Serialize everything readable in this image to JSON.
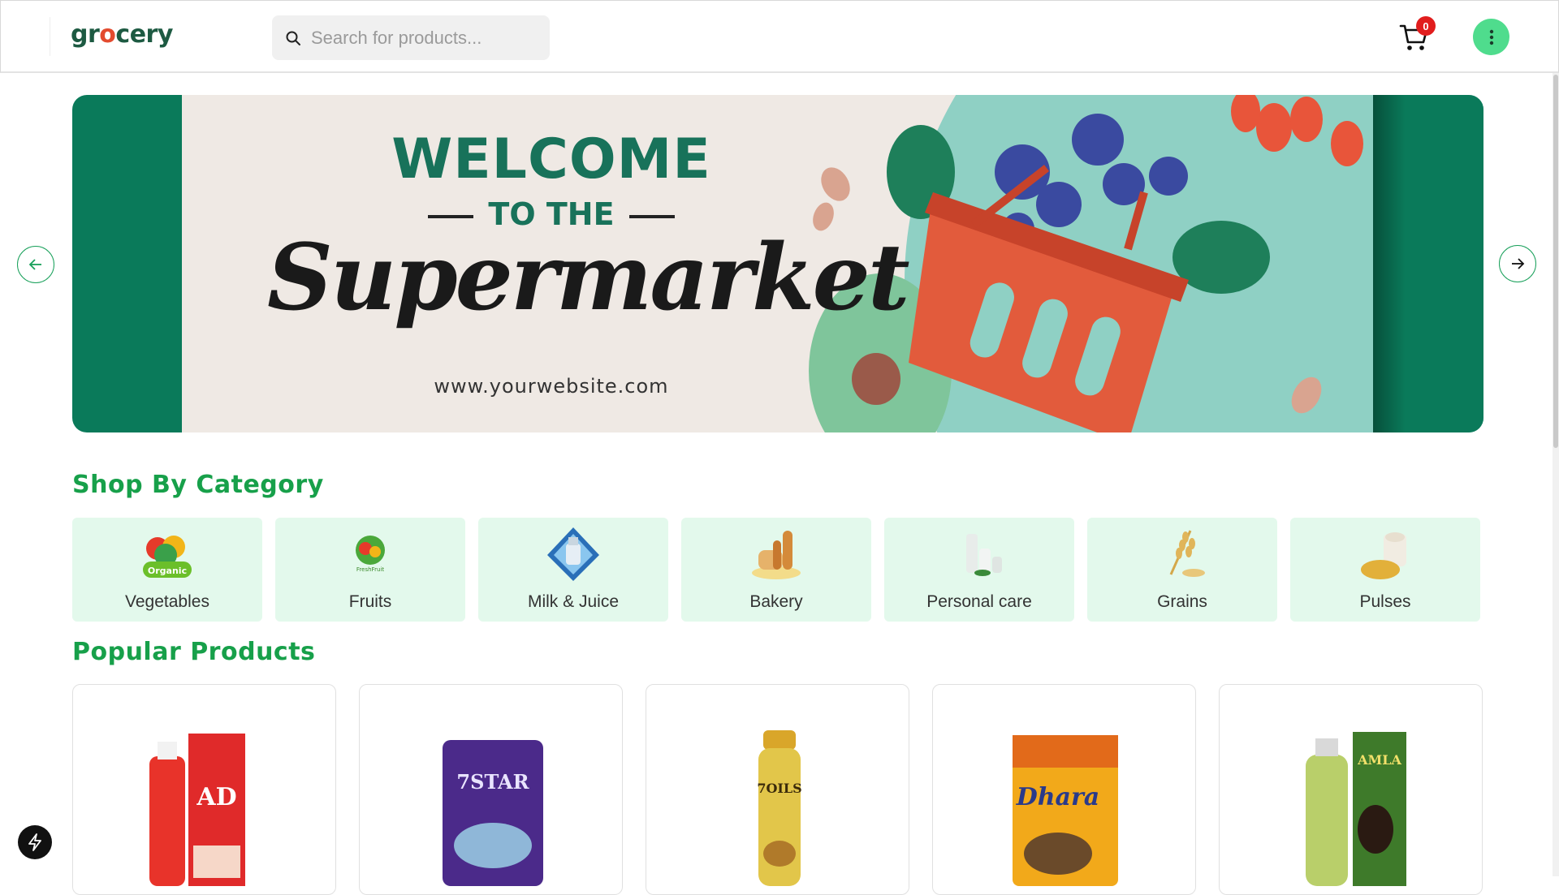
{
  "header": {
    "logo_prefix": "gr",
    "logo_o": "o",
    "logo_suffix": "cery",
    "search_placeholder": "Search for products...",
    "cart_count": "0"
  },
  "banner": {
    "welcome": "WELCOME",
    "to_the": "TO THE",
    "script_title": "Supermarket",
    "website": "www.yourwebsite.com"
  },
  "sections": {
    "categories_title": "Shop By Category",
    "popular_title": "Popular Products"
  },
  "categories": [
    {
      "label": "Vegetables",
      "icon": "vegetables-icon"
    },
    {
      "label": "Fruits",
      "icon": "fruits-icon"
    },
    {
      "label": "Milk & Juice",
      "icon": "milk-juice-icon"
    },
    {
      "label": "Bakery",
      "icon": "bakery-icon"
    },
    {
      "label": "Personal care",
      "icon": "personal-care-icon"
    },
    {
      "label": "Grains",
      "icon": "grains-icon"
    },
    {
      "label": "Pulses",
      "icon": "pulses-icon"
    }
  ],
  "products": [
    {
      "label_text": "AD",
      "icon": "ad-vitamin-oil-image"
    },
    {
      "label_text": "7STAR",
      "icon": "rice-bag-image"
    },
    {
      "label_text": "7OILS",
      "icon": "hair-oil-bottle-image"
    },
    {
      "label_text": "Dhara",
      "icon": "mustard-oil-pouch-image"
    },
    {
      "label_text": "AMLA",
      "icon": "amla-hair-oil-image"
    }
  ],
  "colors": {
    "brand_green": "#17a04a",
    "logo_green": "#1d5a42",
    "accent_red": "#e34b2f",
    "category_bg": "#e3f9ec",
    "banner_teal": "#0a7a5a",
    "menu_button": "#4fdc8d",
    "badge_red": "#e11d1d"
  }
}
